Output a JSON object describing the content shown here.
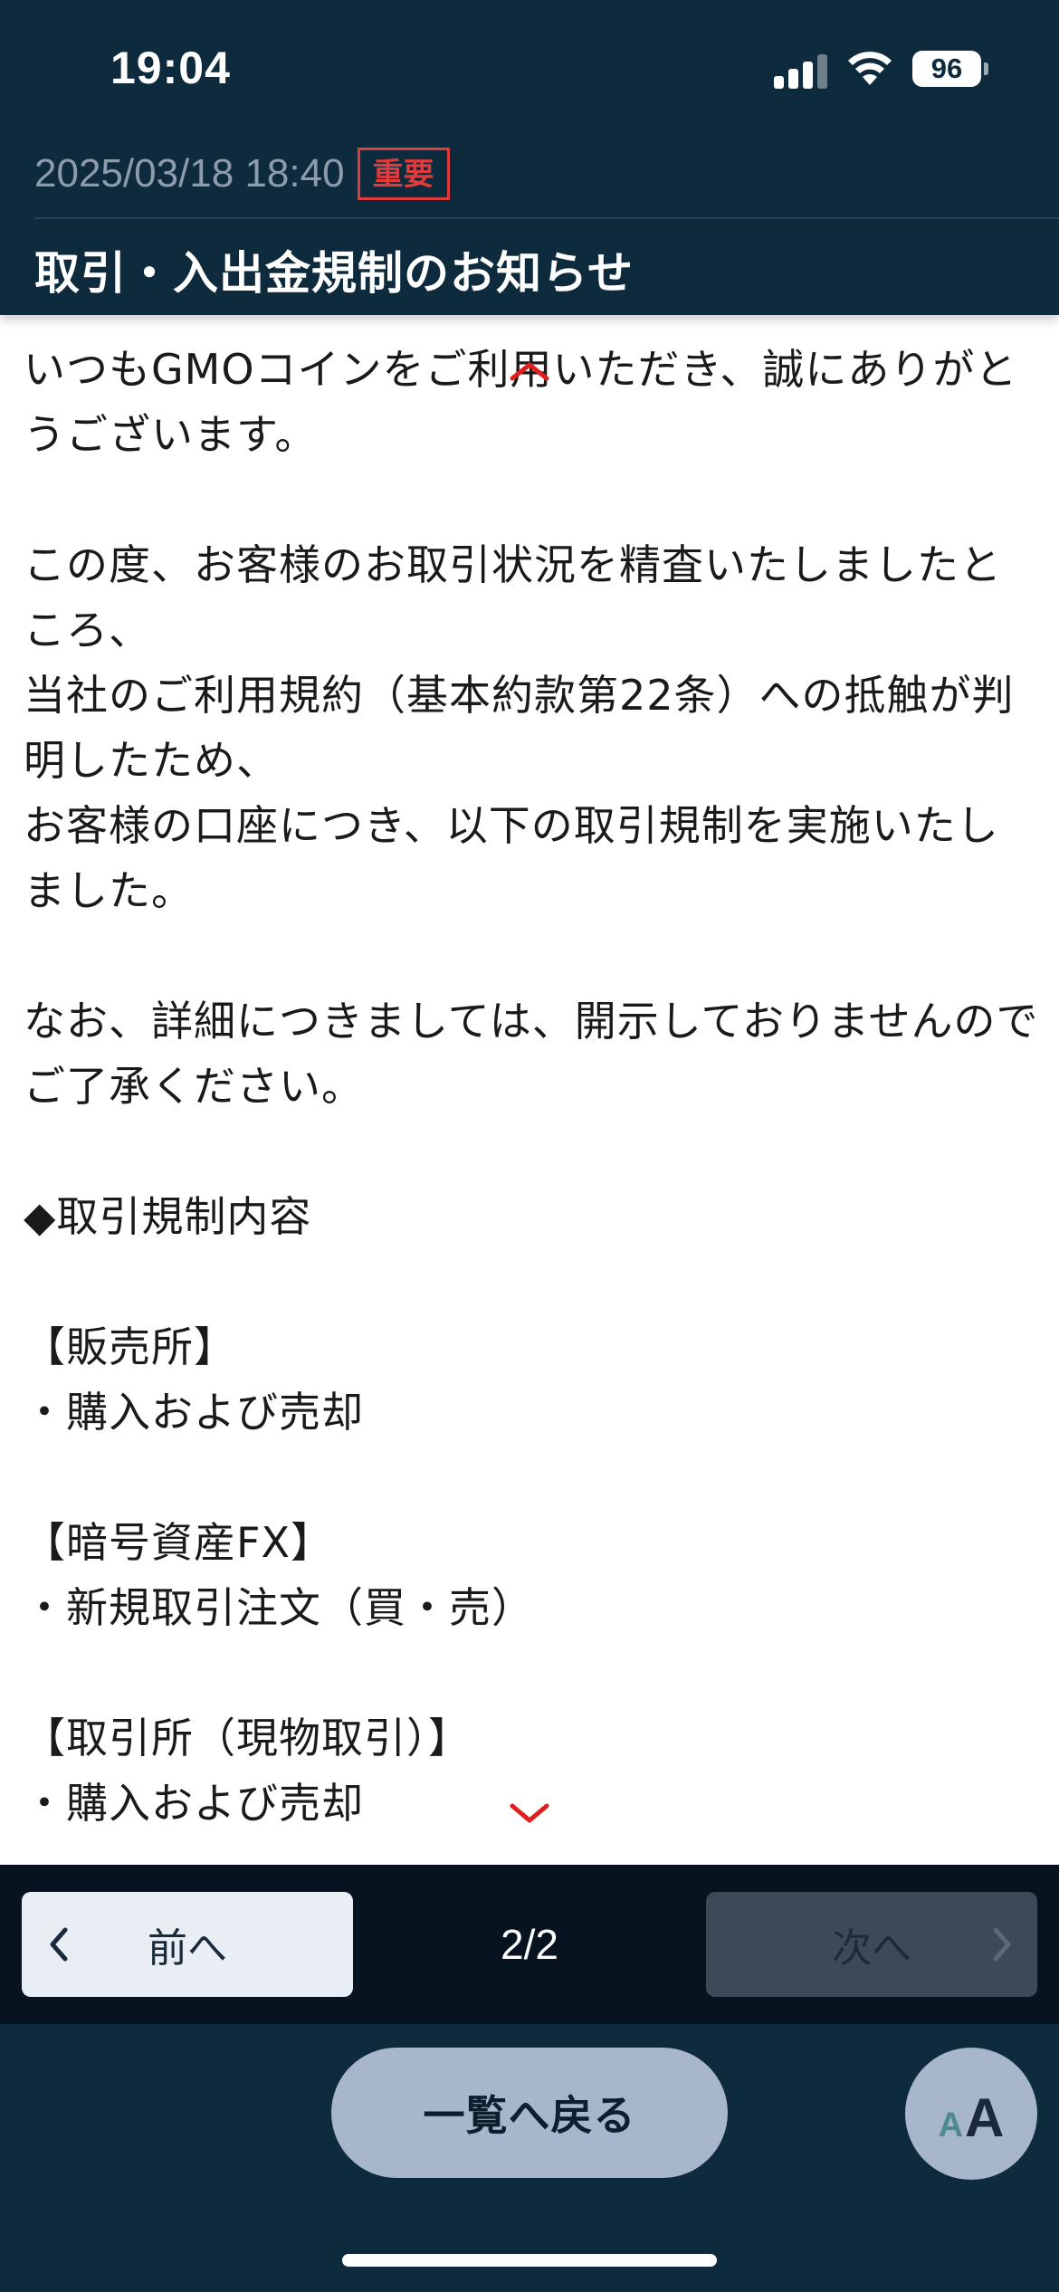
{
  "status_bar": {
    "time": "19:04",
    "battery": "96"
  },
  "notice": {
    "date": "2025/03/18 18:40",
    "badge": "重要",
    "title": "取引・入出金規制のお知らせ"
  },
  "body": {
    "p1": "いつもGMOコインをご利用いただき、誠にありがとうございます。",
    "p2a": "この度、お客様のお取引状況を精査いたしましたところ、",
    "p2b": "当社のご利用規約（基本約款第22条）への抵触が判明したため、",
    "p2c": "お客様の口座につき、以下の取引規制を実施いたしました。",
    "p3": "なお、詳細につきましては、開示しておりませんのでご了承ください。",
    "section": "◆取引規制内容",
    "items": [
      {
        "heading": "【販売所】",
        "detail": "・購入および売却"
      },
      {
        "heading": "【暗号資産FX】",
        "detail": "・新規取引注文（買・売）"
      },
      {
        "heading": "【取引所（現物取引）】",
        "detail": "・購入および売却"
      }
    ]
  },
  "pager": {
    "prev_label": "前へ",
    "page": "2/2",
    "next_label": "次へ"
  },
  "bottom": {
    "back_label": "一覧へ戻る",
    "font_small": "A",
    "font_large": "A"
  },
  "colors": {
    "header_bg": "#0e2a3d",
    "badge_red": "#e03a3a",
    "scroll_arrow": "#e02020"
  },
  "icons": [
    "signal-icon",
    "wifi-icon",
    "battery-icon",
    "chevron-up-icon",
    "chevron-down-icon",
    "chevron-left-icon",
    "chevron-right-icon"
  ]
}
